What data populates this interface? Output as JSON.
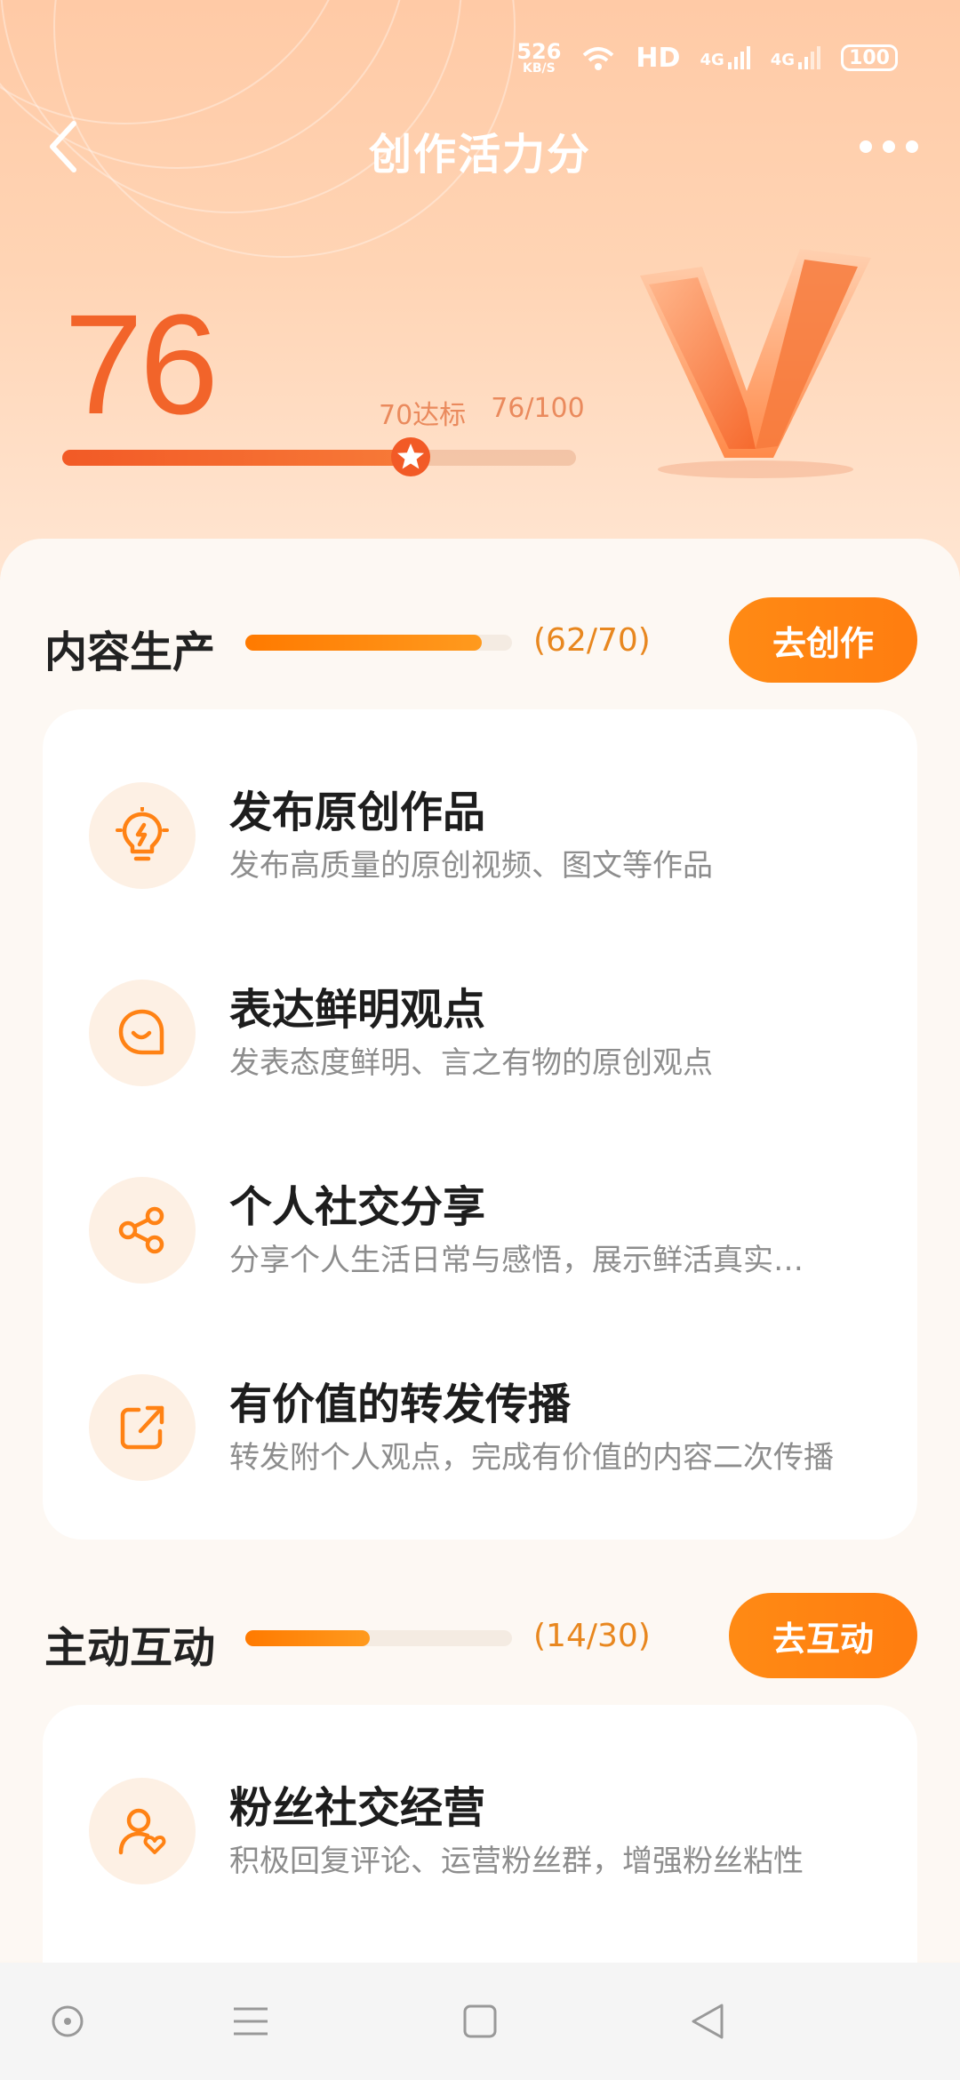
{
  "status_bar": {
    "net_speed_value": "526",
    "net_speed_unit": "KB/S",
    "hd_label": "HD",
    "signal_1": "4G",
    "signal_2": "4G",
    "battery": "100"
  },
  "header": {
    "title": "创作活力分",
    "back_icon": "chevron-left-icon",
    "more_icon": "more-dots-icon"
  },
  "score": {
    "value": "76",
    "threshold_label": "70达标",
    "ratio_label": "76/100",
    "progress_fraction": 0.76,
    "threshold_fraction": 0.7,
    "accent": "#f2642a"
  },
  "sections": [
    {
      "title": "内容生产",
      "ratio": "(62/70)",
      "progress_fraction": 0.886,
      "button": "去创作",
      "items": [
        {
          "icon": "lightbulb-icon",
          "title": "发布原创作品",
          "desc": "发布高质量的原创视频、图文等作品"
        },
        {
          "icon": "chat-smile-icon",
          "title": "表达鲜明观点",
          "desc": "发表态度鲜明、言之有物的原创观点"
        },
        {
          "icon": "share-icon",
          "title": "个人社交分享",
          "desc": "分享个人生活日常与感悟，展示鲜活真实…"
        },
        {
          "icon": "forward-icon",
          "title": "有价值的转发传播",
          "desc": "转发附个人观点，完成有价值的内容二次传播"
        }
      ]
    },
    {
      "title": "主动互动",
      "ratio": "(14/30)",
      "progress_fraction": 0.467,
      "button": "去互动",
      "items": [
        {
          "icon": "user-heart-icon",
          "title": "粉丝社交经营",
          "desc": "积极回复评论、运营粉丝群，增强粉丝粘性"
        }
      ]
    }
  ],
  "nav_bar": [
    "circle-icon",
    "menu-icon",
    "square-icon",
    "triangle-back-icon"
  ],
  "colors": {
    "orange": "#ff8214",
    "text_dark": "#1d1d1d",
    "text_gray": "#8d8d8d"
  }
}
